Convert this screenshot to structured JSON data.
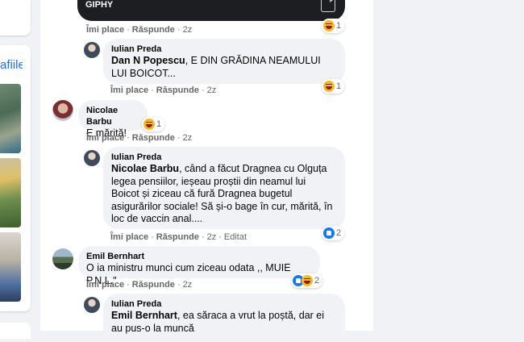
{
  "left_column": {
    "partial_link": "afiile"
  },
  "giphy": {
    "label": "GIPHY"
  },
  "actions": {
    "like": "Îmi place",
    "reply": "Răspunde",
    "edited": "Editat"
  },
  "comments": [
    {
      "actions_time": "2z",
      "reaction_count": "1"
    },
    {
      "author": "Iulian Preda",
      "mention": "Dan N Popescu",
      "text": ", E DIN GRĂDINA NEAMULUI LUI BOICOT...",
      "time": "2z",
      "reaction_count": "1"
    },
    {
      "author": "Nicolae Barbu",
      "text": "E mărită!",
      "time": "2z",
      "reaction_count": "1"
    },
    {
      "author": "Iulian Preda",
      "mention": "Nicolae Barbu",
      "text": ", când a făcut Dragnea cu Olguța legea pensiilor, ieșeau proștii din neamul lui Boicot și ziceau că fură Dragnea bugetul asigurărilor sociale! Să și-o bage în cur, mărită, în loc de vaccin anal....",
      "time": "2z",
      "reaction_count": "2"
    },
    {
      "author": "Emil Bernhart",
      "text": "O ia ministru munci cum ziceau odata ,, MUIE P.N.L.\"",
      "time": "2z",
      "reaction_count": "2"
    },
    {
      "author": "Iulian Preda",
      "mention": "Emil Bernhart",
      "text": ", ea săraca a vrut la poștă, dar ei au pus-o la muncă"
    }
  ],
  "colors": {
    "link": "#216fdb",
    "bubble": "#f0f2f5",
    "meta": "#65676b",
    "like_blue": "#1877f2",
    "haha_yellow": "#f7b928"
  }
}
